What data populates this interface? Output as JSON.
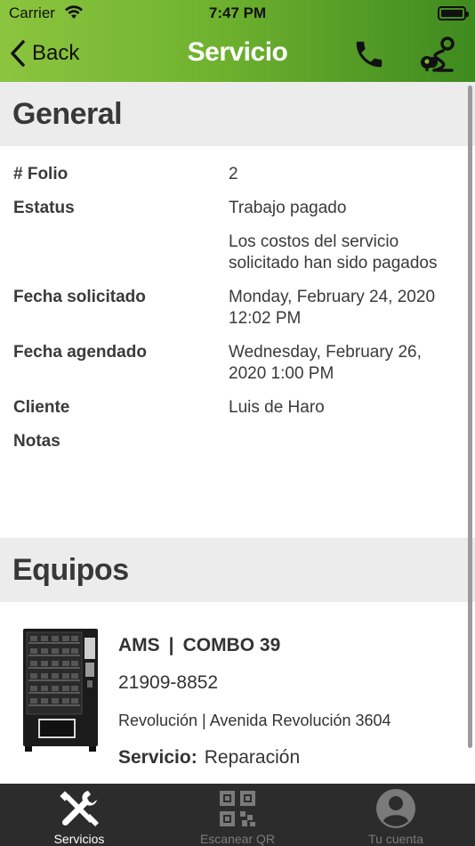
{
  "status_bar": {
    "carrier": "Carrier",
    "time": "7:47 PM"
  },
  "nav": {
    "back_label": "Back",
    "title": "Servicio"
  },
  "general": {
    "title": "General",
    "rows": [
      {
        "label": "# Folio",
        "value": "2"
      },
      {
        "label": "Estatus",
        "value": "Trabajo pagado"
      },
      {
        "label": "",
        "value": "Los costos del servicio solicitado han sido pagados"
      },
      {
        "label": "Fecha solicitado",
        "value": "Monday, February 24, 2020 12:02 PM"
      },
      {
        "label": "Fecha agendado",
        "value": "Wednesday, February 26, 2020 1:00 PM"
      },
      {
        "label": "Cliente",
        "value": "Luis de Haro"
      },
      {
        "label": "Notas",
        "value": ""
      }
    ]
  },
  "equipos": {
    "title": "Equipos",
    "items": [
      {
        "brand": "AMS",
        "separator": "|",
        "model": "COMBO 39",
        "serial": "21909-8852",
        "address": "Revolución | Avenida Revolución 3604",
        "service_label": "Servicio:",
        "service_value": "Reparación"
      }
    ]
  },
  "tabbar": {
    "tabs": [
      {
        "label": "Servicios",
        "icon": "tools-icon",
        "active": true
      },
      {
        "label": "Escanear QR",
        "icon": "qr-code-icon",
        "active": false
      },
      {
        "label": "Tu cuenta",
        "icon": "account-icon",
        "active": false
      }
    ]
  },
  "colors": {
    "header_start": "#8cc53f",
    "header_end": "#3f8a1f",
    "tabbar_bg": "#2c2c2c",
    "section_bg": "#ececec"
  }
}
